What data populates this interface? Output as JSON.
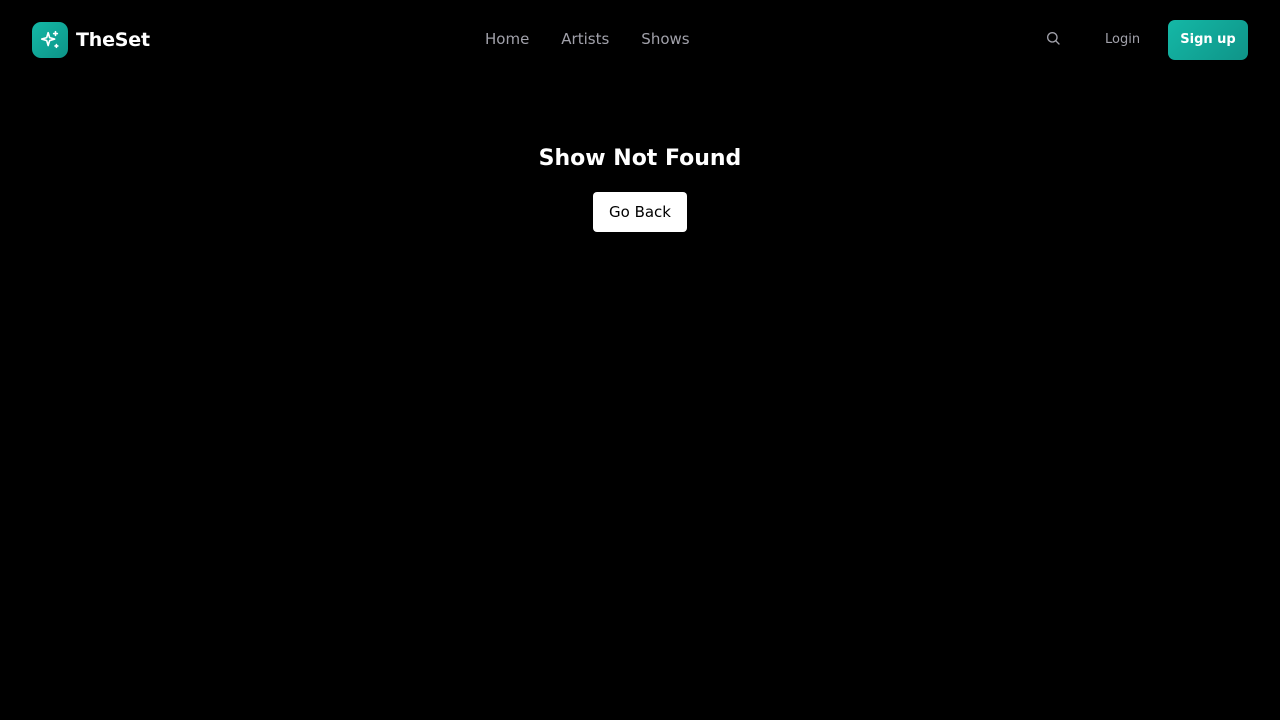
{
  "brand": {
    "name": "TheSet",
    "logo_icon": "sparkles-icon",
    "accent_color": "#14b8a6"
  },
  "nav": {
    "items": [
      {
        "label": "Home"
      },
      {
        "label": "Artists"
      },
      {
        "label": "Shows"
      }
    ]
  },
  "header": {
    "search_icon": "search-icon",
    "login_label": "Login",
    "signup_label": "Sign up"
  },
  "main": {
    "title": "Show Not Found",
    "go_back_label": "Go Back"
  }
}
